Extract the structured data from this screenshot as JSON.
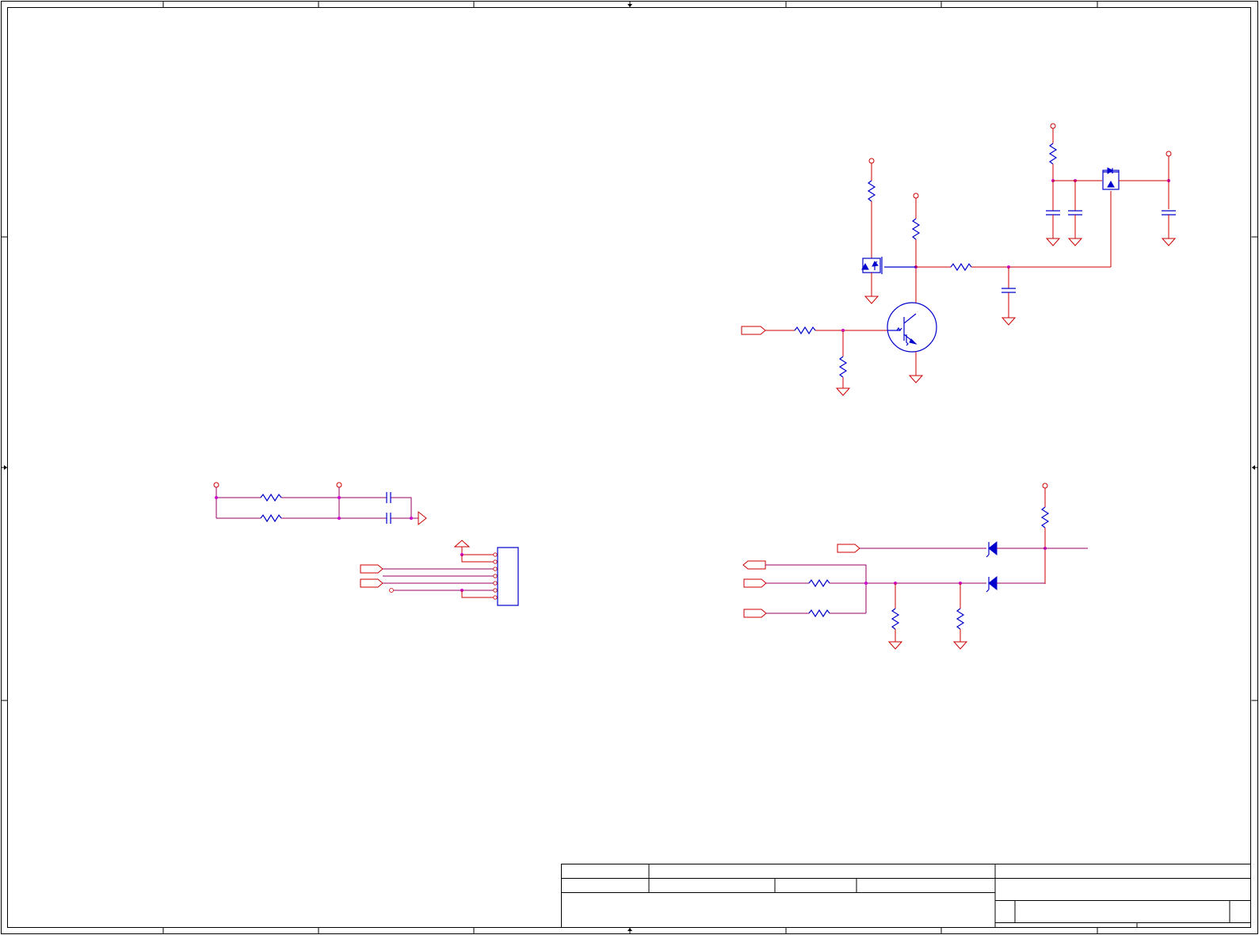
{
  "sheet": {
    "title_block": {
      "title": "",
      "size": "",
      "document_number": "",
      "revision": "",
      "date": "",
      "sheet": ""
    }
  }
}
